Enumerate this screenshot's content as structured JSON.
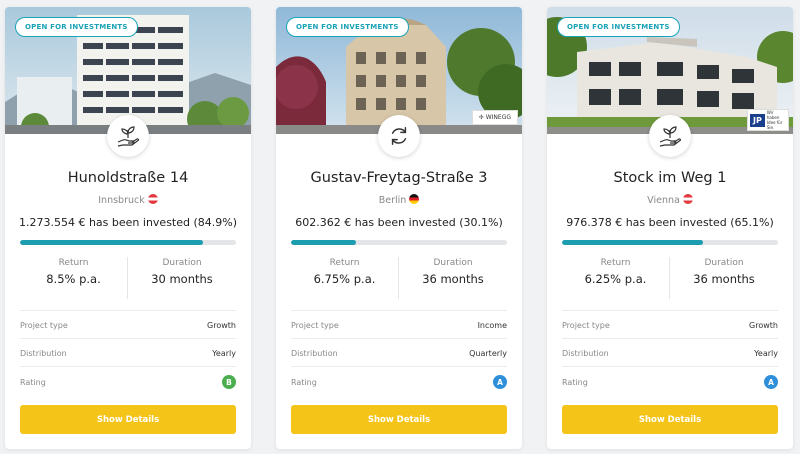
{
  "colors": {
    "accent": "#1c9db0",
    "button": "#f4c419",
    "rating_b": "#4cae4f",
    "rating_a": "#2f8fd8"
  },
  "labels": {
    "return": "Return",
    "duration": "Duration",
    "project_type": "Project type",
    "distribution": "Distribution",
    "rating": "Rating",
    "show_details": "Show Details"
  },
  "projects": [
    {
      "badge": "OPEN FOR INVESTMENTS",
      "type_icon": "hand-plant-icon",
      "title": "Hunoldstraße 14",
      "city": "Innsbruck",
      "flag": "austria-flag-icon",
      "invested": "1.273.554 € has been invested (84.9%)",
      "progress": 0.849,
      "return_value": "8.5% p.a.",
      "duration_value": "30 months",
      "project_type": "Growth",
      "distribution": "Yearly",
      "rating": "B"
    },
    {
      "badge": "OPEN FOR INVESTMENTS",
      "type_icon": "refresh-cycle-icon",
      "title": "Gustav-Freytag-Straße 3",
      "city": "Berlin",
      "flag": "germany-flag-icon",
      "logo": "WINEGG",
      "invested": "602.362 € has been invested (30.1%)",
      "progress": 0.301,
      "return_value": "6.75% p.a.",
      "duration_value": "36 months",
      "project_type": "Income",
      "distribution": "Quarterly",
      "rating": "A"
    },
    {
      "badge": "OPEN FOR INVESTMENTS",
      "type_icon": "hand-plant-icon",
      "title": "Stock im Weg 1",
      "city": "Vienna",
      "flag": "austria-flag-icon",
      "logo": "JP",
      "logo_text": "Wir haben Idee für Sie.",
      "invested": "976.378 € has been invested (65.1%)",
      "progress": 0.651,
      "return_value": "6.25% p.a.",
      "duration_value": "36 months",
      "project_type": "Growth",
      "distribution": "Yearly",
      "rating": "A"
    }
  ]
}
